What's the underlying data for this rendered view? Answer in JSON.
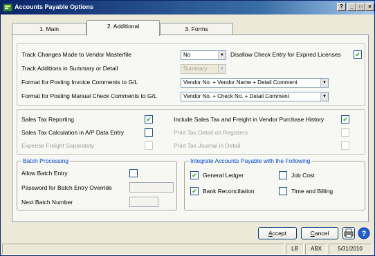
{
  "window": {
    "title": "Accounts Payable Options",
    "controls": {
      "help": "?",
      "minimize": "_",
      "maximize": "□",
      "close": "×"
    }
  },
  "tabs": [
    {
      "label": "1. Main",
      "active": false
    },
    {
      "label": "2. Additional",
      "active": true
    },
    {
      "label": "3. Forms",
      "active": false
    }
  ],
  "section1": {
    "track_changes_label": "Track Changes Made to Vendor Masterfile",
    "track_changes_value": "No",
    "disallow_label": "Disallow Check Entry for Expired Licenses",
    "disallow_checked": true,
    "track_additions_label": "Track Additions in Summary or Detail",
    "track_additions_value": "Summary",
    "format_invoice_label": "Format for Posting Invoice Comments to G/L",
    "format_invoice_value": "Vendor No. + Vendor Name + Detail Comment",
    "format_manual_label": "Format for Posting Manual Check Comments to G/L",
    "format_manual_value": "Vendor No. + Check No. + Detail Comment"
  },
  "section2": {
    "sales_tax_reporting_label": "Sales Tax Reporting",
    "sales_tax_reporting_checked": true,
    "include_sales_tax_label": "Include Sales Tax and Freight in Vendor Purchase History",
    "include_sales_tax_checked": true,
    "sales_tax_calc_label": "Sales Tax Calculation in A/P Data Entry",
    "sales_tax_calc_checked": false,
    "print_tax_detail_label": "Print Tax Detail on Registers",
    "print_tax_detail_checked": false,
    "expense_freight_label": "Expense Freight Separately",
    "expense_freight_checked": false,
    "print_tax_journal_label": "Print Tax Journal in Detail",
    "print_tax_journal_checked": false
  },
  "batch": {
    "legend": "Batch Processing",
    "allow_label": "Allow Batch Entry",
    "allow_checked": false,
    "password_label": "Password for Batch Entry Override",
    "password_value": "",
    "next_label": "Next Batch Number",
    "next_value": ""
  },
  "integrate": {
    "legend": "Integrate Accounts Payable with the Following",
    "general_ledger_label": "General Ledger",
    "general_ledger_checked": true,
    "job_cost_label": "Job Cost",
    "job_cost_checked": false,
    "bank_rec_label": "Bank Reconciliation",
    "bank_rec_checked": true,
    "time_billing_label": "Time and Billing",
    "time_billing_checked": false
  },
  "buttons": {
    "accept_hotkey": "A",
    "accept_rest": "ccept",
    "cancel_hotkey": "C",
    "cancel_rest": "ancel"
  },
  "status": {
    "user": "LB",
    "company": "ABX",
    "date": "5/31/2010"
  },
  "check_glyph": "✔",
  "colors": {
    "title_start": "#0a246a",
    "title_end": "#a6caf0",
    "legend": "#0046d5",
    "check": "#21a121"
  }
}
